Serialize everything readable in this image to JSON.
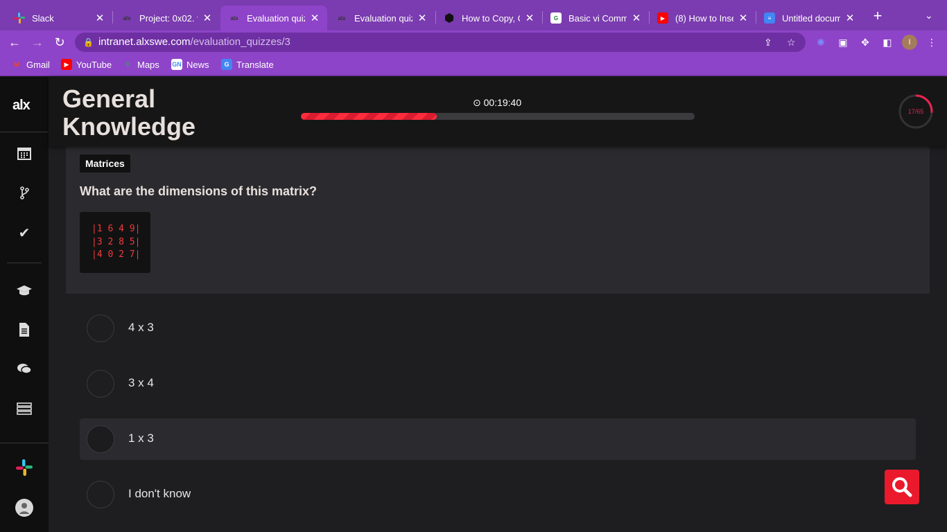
{
  "browser": {
    "tabs": [
      {
        "title": "Slack",
        "icon": "slack-icon"
      },
      {
        "title": "Project: 0x02. vi",
        "icon": "alx-icon"
      },
      {
        "title": "Evaluation quizzes",
        "icon": "alx-icon",
        "active": true
      },
      {
        "title": "Evaluation quizzes",
        "icon": "alx-icon"
      },
      {
        "title": "How to Copy, Cut",
        "icon": "hexagon-icon"
      },
      {
        "title": "Basic vi Commands",
        "icon": "doc-icon"
      },
      {
        "title": "(8) How to Insert",
        "icon": "youtube-icon"
      },
      {
        "title": "Untitled document",
        "icon": "google-docs-icon"
      }
    ],
    "url_host": "intranet.alxswe.com",
    "url_path": "/evaluation_quizzes/3",
    "profile_initial": "I",
    "bookmarks": [
      {
        "label": "Gmail",
        "icon": "gmail-icon"
      },
      {
        "label": "YouTube",
        "icon": "youtube-icon"
      },
      {
        "label": "Maps",
        "icon": "maps-icon"
      },
      {
        "label": "News",
        "icon": "news-icon"
      },
      {
        "label": "Translate",
        "icon": "translate-icon"
      }
    ]
  },
  "app": {
    "logo": "alx",
    "quiz_title": "General Knowledge",
    "timer": "00:19:40",
    "progress_fraction": 0.345,
    "counter": "17/65",
    "counter_fraction": 0.2615,
    "colors": {
      "accent": "#ea1a2c",
      "progress": "#ff2c3d",
      "ring": "#e8254f",
      "code": "#f23b3b"
    }
  },
  "question": {
    "tag": "Matrices",
    "text": "What are the dimensions of this matrix?",
    "matrix_lines": [
      "|1 6 4 9|",
      "|3 2 8 5|",
      "|4 0 2 7|"
    ]
  },
  "answers": [
    {
      "label": "4 x 3"
    },
    {
      "label": "3 x 4"
    },
    {
      "label": "1 x 3"
    },
    {
      "label": "I don't know"
    }
  ]
}
